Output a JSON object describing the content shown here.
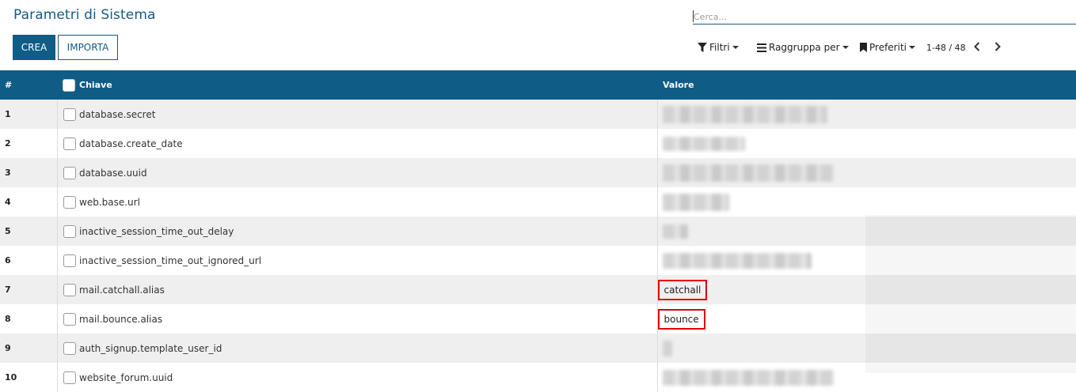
{
  "page": {
    "title": "Parametri di Sistema"
  },
  "search": {
    "placeholder": "Cerca..."
  },
  "buttons": {
    "create": "CREA",
    "import": "IMPORTA"
  },
  "toolbar": {
    "filters": "Filtri",
    "group_by": "Raggruppa per",
    "favorites": "Preferiti",
    "pager": "1-48 / 48"
  },
  "table": {
    "headers": {
      "number": "#",
      "key": "Chiave",
      "value": "Valore"
    },
    "rows": [
      {
        "n": "1",
        "key": "database.secret",
        "value": ""
      },
      {
        "n": "2",
        "key": "database.create_date",
        "value": ""
      },
      {
        "n": "3",
        "key": "database.uuid",
        "value": ""
      },
      {
        "n": "4",
        "key": "web.base.url",
        "value": ""
      },
      {
        "n": "5",
        "key": "inactive_session_time_out_delay",
        "value": ""
      },
      {
        "n": "6",
        "key": "inactive_session_time_out_ignored_url",
        "value": ""
      },
      {
        "n": "7",
        "key": "mail.catchall.alias",
        "value": "catchall"
      },
      {
        "n": "8",
        "key": "mail.bounce.alias",
        "value": "bounce"
      },
      {
        "n": "9",
        "key": "auth_signup.template_user_id",
        "value": ""
      },
      {
        "n": "10",
        "key": "website_forum.uuid",
        "value": ""
      }
    ]
  },
  "colors": {
    "brand": "#0f5c86",
    "highlight_border": "#e00000"
  }
}
